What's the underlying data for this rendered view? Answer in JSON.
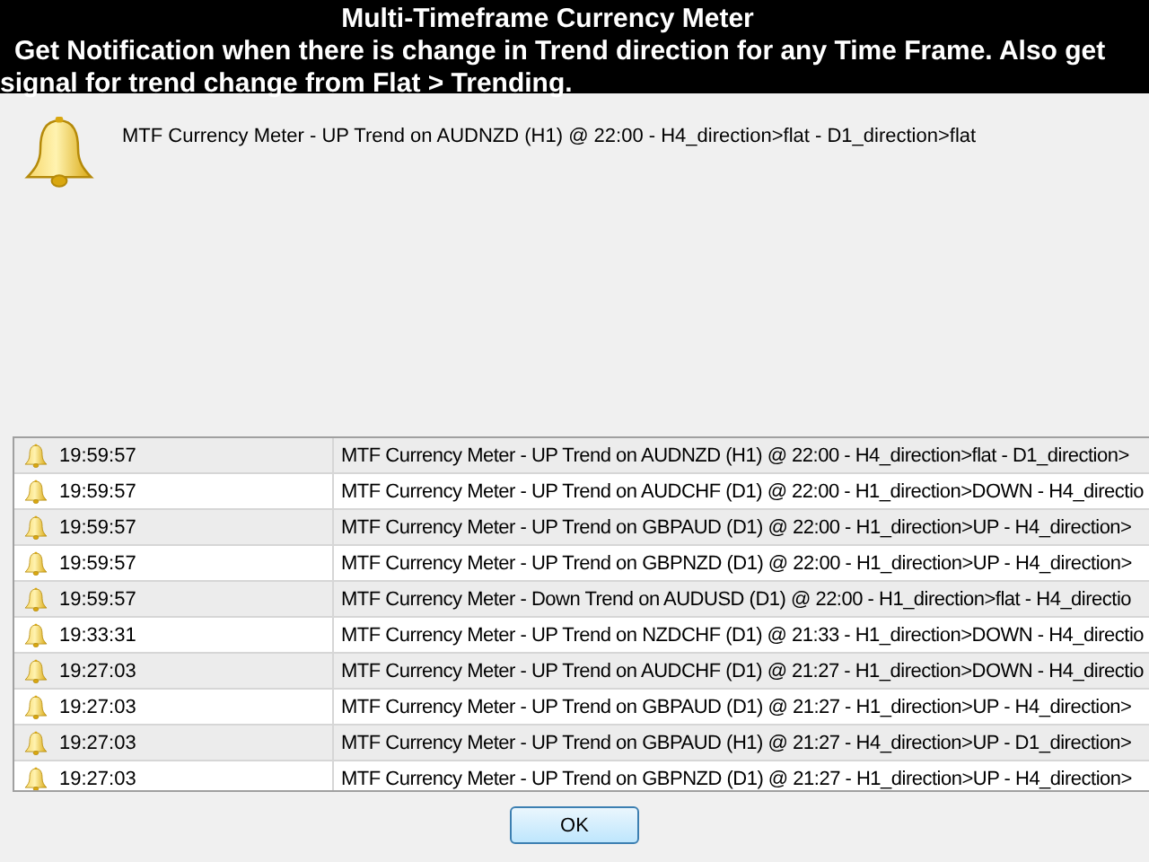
{
  "header": {
    "title": "Multi-Timeframe Currency Meter",
    "description": "Get Notification when there is change in Trend direction for any Time Frame. Also get signal for trend change from Flat > Trending."
  },
  "alert": {
    "message": "MTF Currency Meter - UP Trend on AUDNZD (H1) @ 22:00 - H4_direction>flat - D1_direction>flat"
  },
  "alerts_list": [
    {
      "time": "19:59:57",
      "message": "MTF Currency Meter - UP Trend on AUDNZD (H1) @ 22:00 - H4_direction>flat - D1_direction>",
      "selected": false
    },
    {
      "time": "19:59:57",
      "message": "MTF Currency Meter - UP Trend on AUDCHF (D1) @ 22:00 - H1_direction>DOWN - H4_directio",
      "selected": false
    },
    {
      "time": "19:59:57",
      "message": "MTF Currency Meter - UP Trend on GBPAUD (D1) @ 22:00 - H1_direction>UP - H4_direction>",
      "selected": false
    },
    {
      "time": "19:59:57",
      "message": "MTF Currency Meter - UP Trend on GBPNZD (D1) @ 22:00 - H1_direction>UP - H4_direction>",
      "selected": false
    },
    {
      "time": "19:59:57",
      "message": "MTF Currency Meter - Down Trend on AUDUSD (D1) @ 22:00 - H1_direction>flat - H4_directio",
      "selected": false
    },
    {
      "time": "19:33:31",
      "message": "MTF Currency Meter - UP Trend on NZDCHF (D1) @ 21:33 - H1_direction>DOWN - H4_directio",
      "selected": false
    },
    {
      "time": "19:27:03",
      "message": "MTF Currency Meter - UP Trend on AUDCHF (D1) @ 21:27 - H1_direction>DOWN - H4_directio",
      "selected": false
    },
    {
      "time": "19:27:03",
      "message": "MTF Currency Meter - UP Trend on GBPAUD (D1) @ 21:27 - H1_direction>UP - H4_direction>",
      "selected": false
    },
    {
      "time": "19:27:03",
      "message": "MTF Currency Meter - UP Trend on GBPAUD (H1) @ 21:27 - H4_direction>UP - D1_direction>",
      "selected": false
    },
    {
      "time": "19:27:03",
      "message": "MTF Currency Meter - UP Trend on GBPNZD (D1) @ 21:27 - H1_direction>UP - H4_direction>",
      "selected": false
    }
  ],
  "buttons": [
    "OK"
  ]
}
